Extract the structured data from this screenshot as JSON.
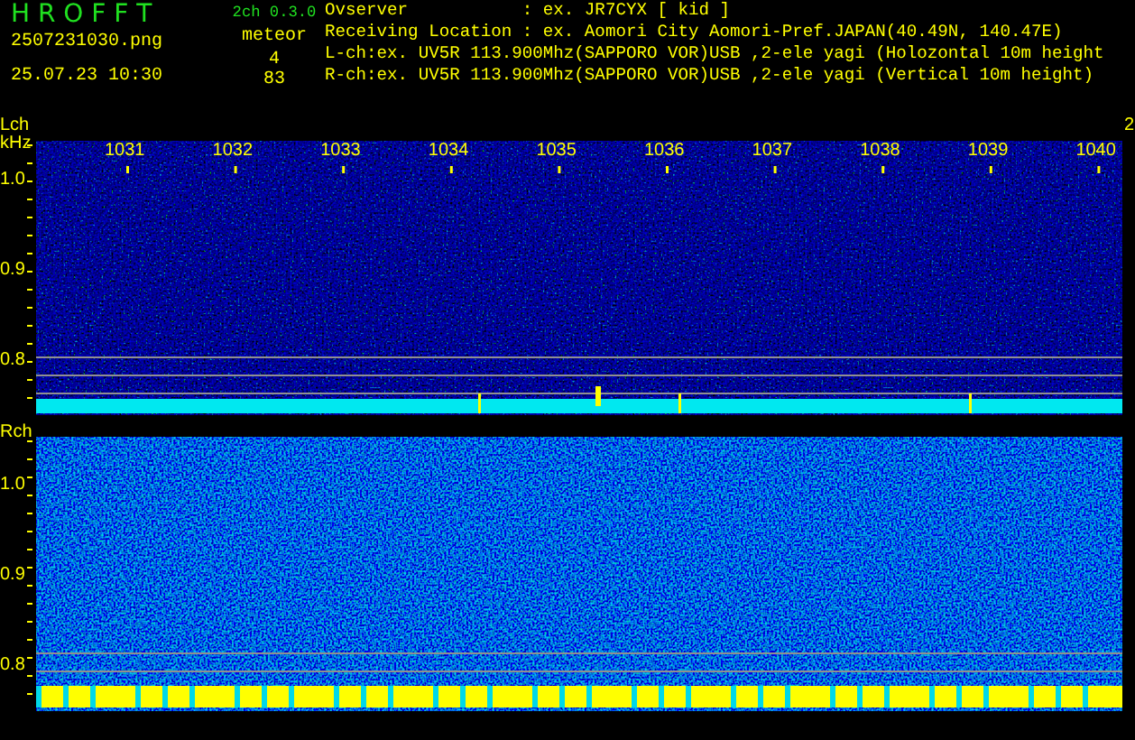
{
  "header": {
    "logo": "H R O F F T",
    "file_name": "2507231030.png",
    "timestamp": "25.07.23 10:30",
    "version": "2ch 0.3.0",
    "meteor_label": "meteor",
    "counts": [
      "4",
      "83"
    ]
  },
  "info_lines": [
    "Ovserver           : ex. JR7CYX [ kid ]",
    "Receiving Location : ex. Aomori City Aomori-Pref.JAPAN(40.49N, 140.47E)",
    "L-ch:ex. UV5R 113.900Mhz(SAPPORO VOR)USB ,2-ele yagi (Holozontal 10m height",
    "R-ch:ex. UV5R 113.900Mhz(SAPPORO VOR)USB ,2-ele yagi (Vertical 10m height)"
  ],
  "channels": [
    {
      "kind": "left",
      "label": "Lch",
      "unit": "kHz",
      "freq_labels": [
        "1031",
        "1032",
        "1033",
        "1034",
        "1035",
        "1036",
        "1037",
        "1038",
        "1039",
        "1040"
      ],
      "edge_label": "2",
      "y_labels": [
        "1.0",
        "0.9",
        "0.8"
      ]
    },
    {
      "kind": "right",
      "label": "Rch",
      "y_labels": [
        "1.0",
        "0.9",
        "0.8"
      ]
    }
  ]
}
